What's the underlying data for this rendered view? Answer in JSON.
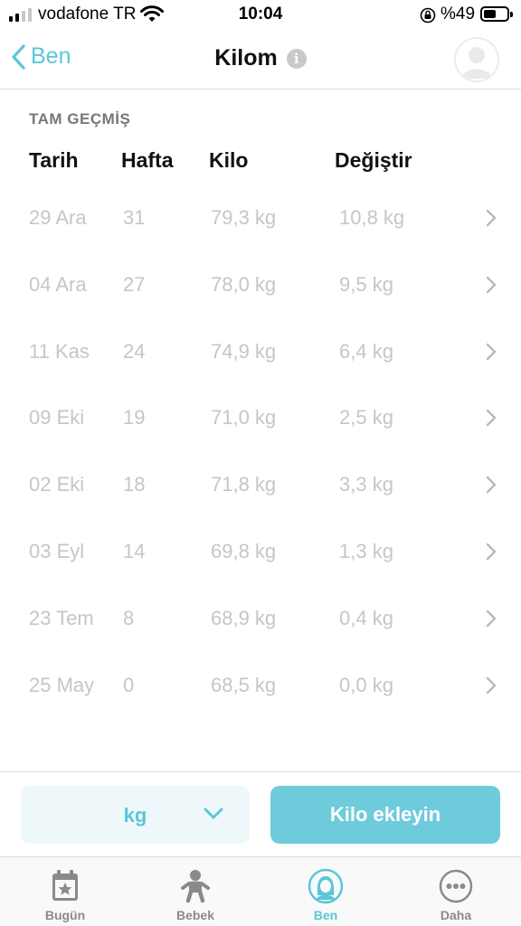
{
  "status_bar": {
    "carrier": "vodafone TR",
    "time": "10:04",
    "battery_percent": "%49"
  },
  "navbar": {
    "back_label": "Ben",
    "title": "Kilom"
  },
  "section_label": "TAM GEÇMİŞ",
  "table": {
    "headers": [
      "Tarih",
      "Hafta",
      "Kilo",
      "Değiştir"
    ],
    "rows": [
      [
        "29 Ara",
        "31",
        "79,3 kg",
        "10,8 kg"
      ],
      [
        "04 Ara",
        "27",
        "78,0 kg",
        "9,5 kg"
      ],
      [
        "11 Kas",
        "24",
        "74,9 kg",
        "6,4 kg"
      ],
      [
        "09 Eki",
        "19",
        "71,0 kg",
        "2,5 kg"
      ],
      [
        "02 Eki",
        "18",
        "71,8 kg",
        "3,3 kg"
      ],
      [
        "03 Eyl",
        "14",
        "69,8 kg",
        "1,3 kg"
      ],
      [
        "23 Tem",
        "8",
        "68,9 kg",
        "0,4 kg"
      ],
      [
        "25 May",
        "0",
        "68,5 kg",
        "0,0 kg"
      ]
    ]
  },
  "unit_select": {
    "value": "kg"
  },
  "add_button": {
    "label": "Kilo ekleyin"
  },
  "tabbar": {
    "tabs": [
      {
        "label": "Bugün",
        "icon": "calendar-star-icon"
      },
      {
        "label": "Bebek",
        "icon": "baby-icon"
      },
      {
        "label": "Ben",
        "icon": "mother-avatar-icon",
        "active": true
      },
      {
        "label": "Daha",
        "icon": "more-dots-icon"
      }
    ]
  },
  "colors": {
    "accent": "#5bc6d8",
    "button": "#6ecbdb",
    "muted_text": "#c6c6c6"
  }
}
